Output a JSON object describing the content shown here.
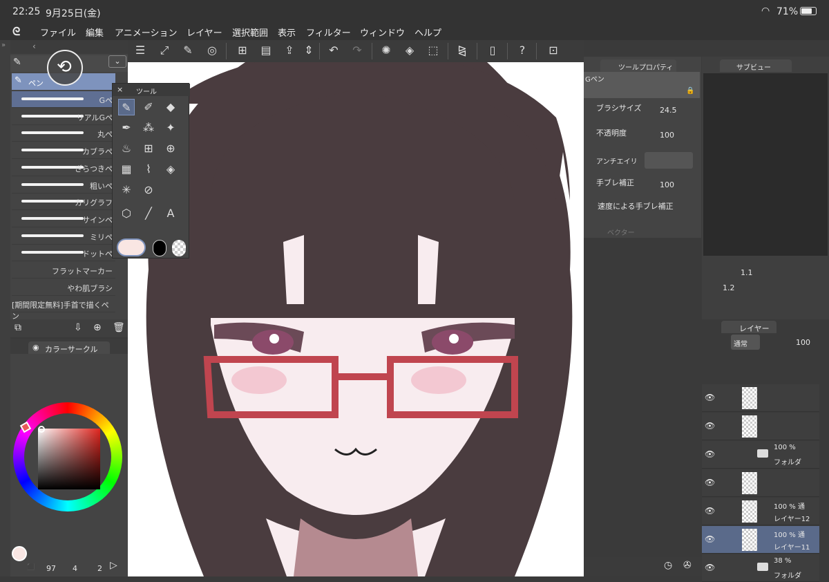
{
  "status": {
    "time": "22:25",
    "date": "9月25日(金)",
    "battery": "71%"
  },
  "menu": [
    "ファイル",
    "編集",
    "アニメーション",
    "レイヤー",
    "選択範囲",
    "表示",
    "フィルター",
    "ウィンドウ",
    "ヘルプ"
  ],
  "brushes": {
    "header": "ペン",
    "items": [
      "Gペ",
      "リアルGペ",
      "丸ペ",
      "カブラペ",
      "ざらつきペ",
      "粗いペ",
      "カリグラフ",
      "サインペ",
      "ミリペ",
      "ドットペ",
      "フラットマーカー",
      "やわ肌ブラシ",
      "[期間限定無料]手首で描くペン"
    ]
  },
  "tool_palette": {
    "title": "ツール"
  },
  "color_panel": {
    "title": "カラーサークル",
    "foreground": "#f9e6e3",
    "bottom": [
      "97",
      "4",
      "2"
    ]
  },
  "tool_property": {
    "title": "ツールプロパティ",
    "brush_name": "Gペン",
    "brush_size_label": "ブラシサイズ",
    "brush_size": "24.5",
    "opacity_label": "不透明度",
    "opacity": "100",
    "antialias_label": "アンチエイリ",
    "stabilize_label": "手ブレ補正",
    "stabilize": "100",
    "speed_label": "速度による手ブレ補正",
    "vector_label": "ベクター"
  },
  "subview": {
    "title": "サブビュー",
    "zoom": "1.1",
    "rotate": "1.2"
  },
  "layers": {
    "title": "レイヤー",
    "blend": "通常",
    "opacity": "100",
    "rows": [
      {
        "l1": "",
        "l2": "",
        "folder": false
      },
      {
        "l1": "",
        "l2": "",
        "folder": false
      },
      {
        "l1": "100 %",
        "l2": "フォルダ",
        "folder": true
      },
      {
        "l1": "",
        "l2": "",
        "folder": false
      },
      {
        "l1": "100 % 通",
        "l2": "レイヤー12",
        "folder": false
      },
      {
        "l1": "100 % 通",
        "l2": "レイヤー11",
        "folder": false
      },
      {
        "l1": "38 %",
        "l2": "フォルダ",
        "folder": true
      }
    ]
  },
  "colors": {
    "accent": "#7e93bd",
    "selected_layer": "#5a6a8a",
    "glasses": "#c0454f",
    "hair": "#4a3c3f"
  }
}
